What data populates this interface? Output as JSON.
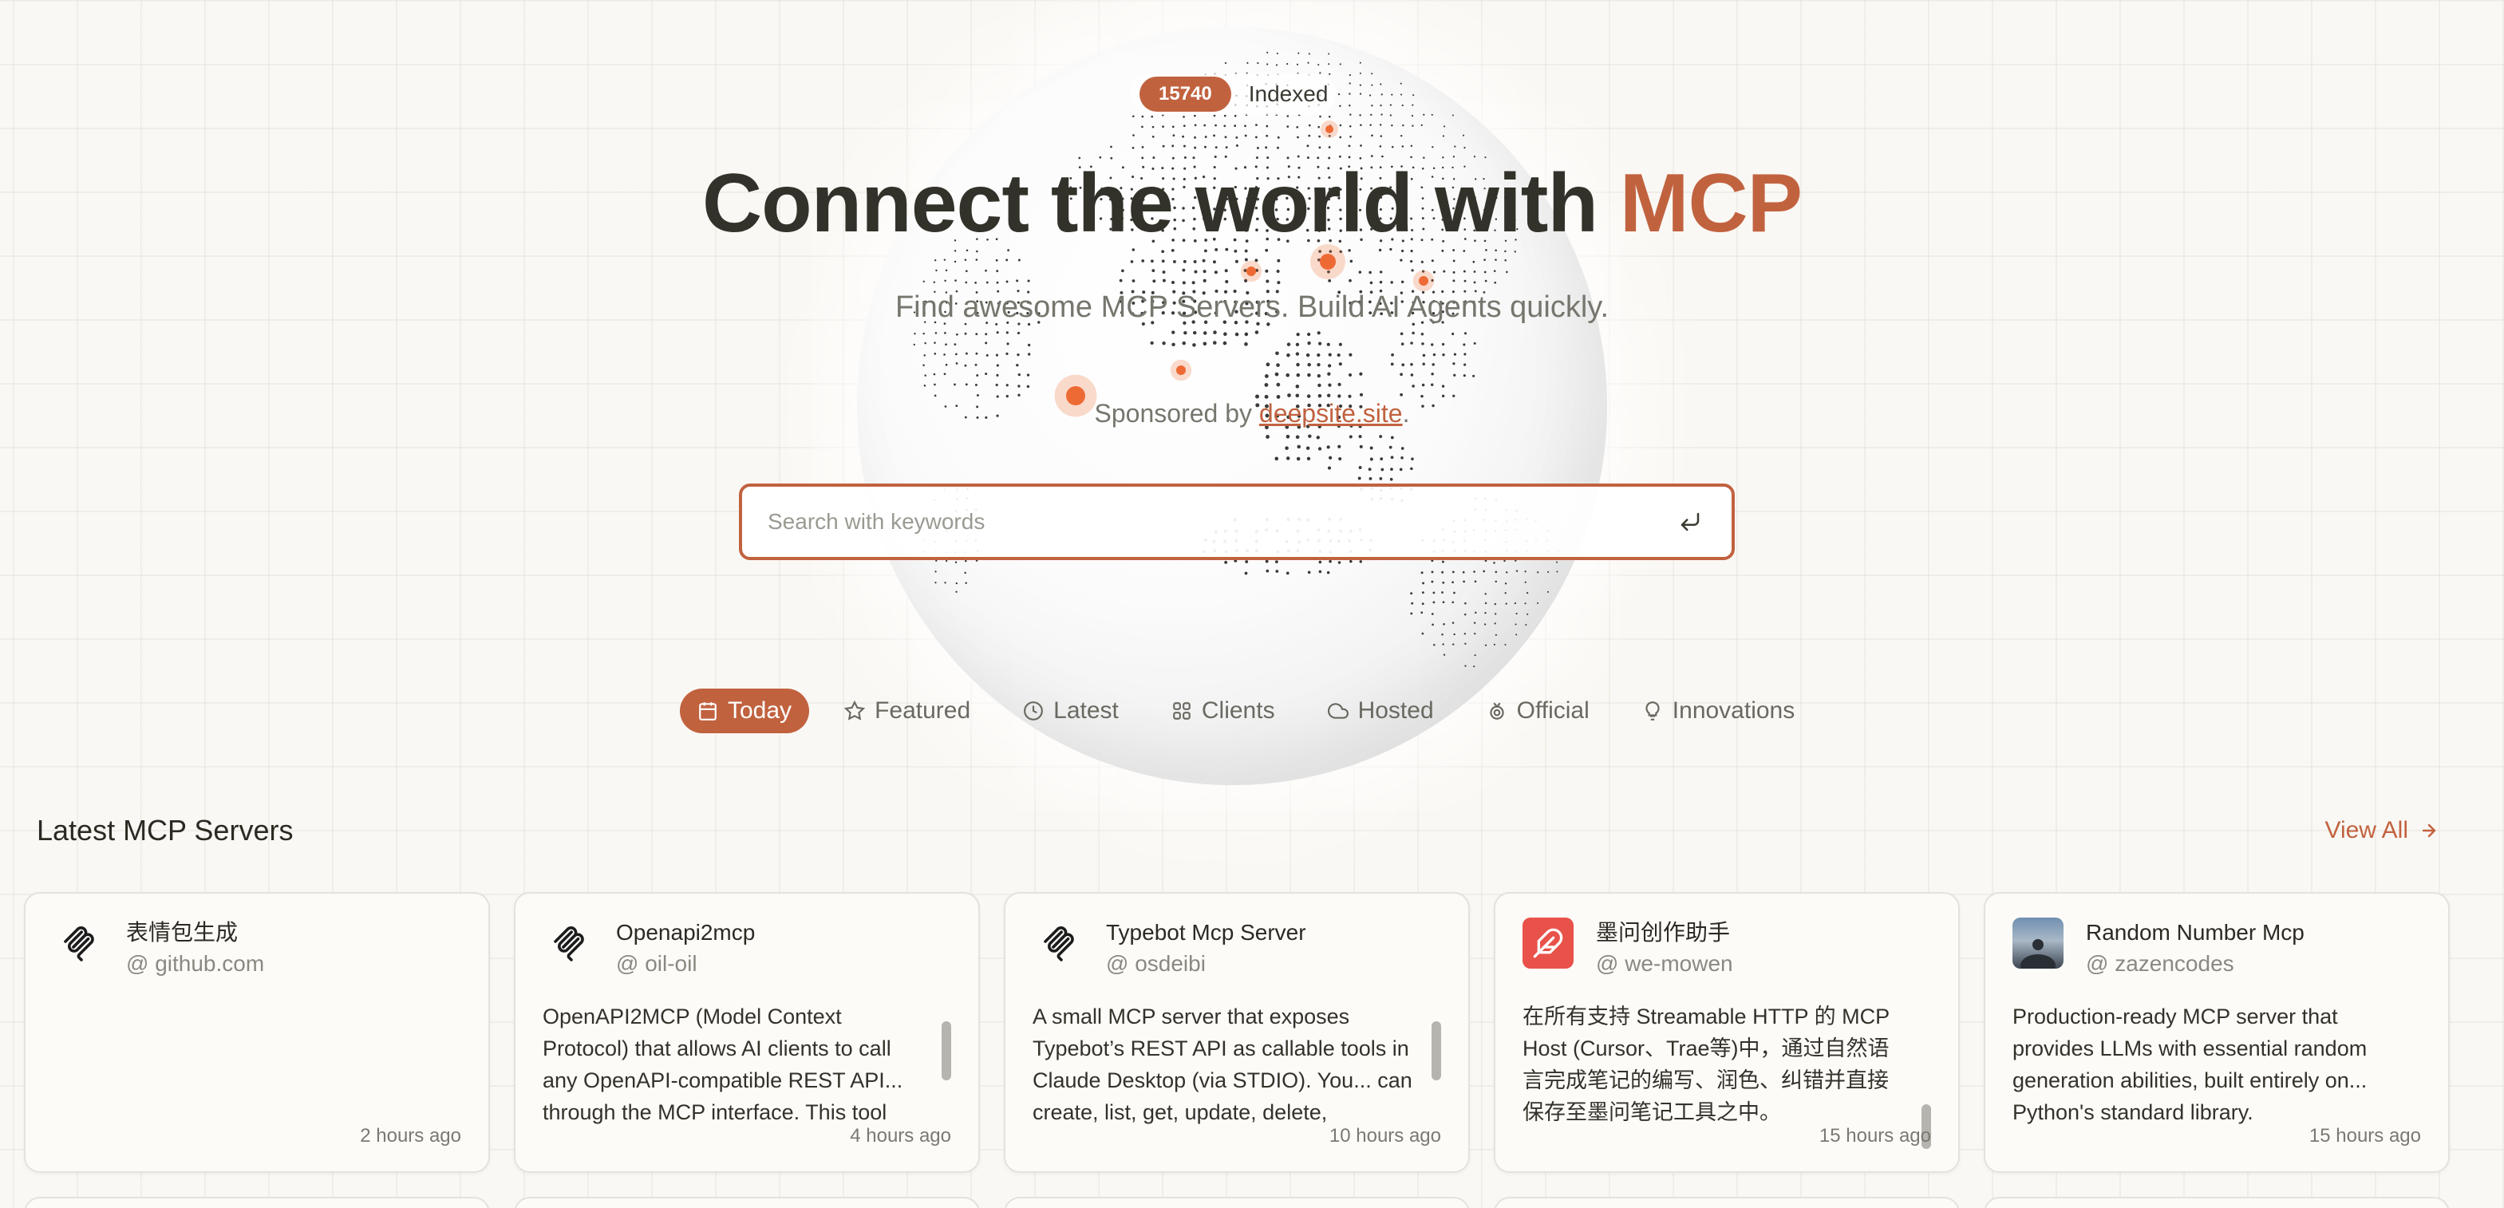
{
  "hero": {
    "indexed_count": "15740",
    "indexed_label": "Indexed",
    "title_main": "Connect the world with ",
    "title_accent": "MCP",
    "subtitle": "Find awesome MCP Servers. Build AI Agents quickly.",
    "sponsor_prefix": "Sponsored by ",
    "sponsor_link": "deepsite.site",
    "sponsor_suffix": "."
  },
  "search": {
    "placeholder": "Search with keywords",
    "value": ""
  },
  "tabs": [
    {
      "label": "Today",
      "icon": "calendar-icon",
      "active": true
    },
    {
      "label": "Featured",
      "icon": "star-icon"
    },
    {
      "label": "Latest",
      "icon": "clock-icon"
    },
    {
      "label": "Clients",
      "icon": "grid-icon"
    },
    {
      "label": "Hosted",
      "icon": "cloud-icon"
    },
    {
      "label": "Official",
      "icon": "medal-icon"
    },
    {
      "label": "Innovations",
      "icon": "lightbulb-icon"
    }
  ],
  "section": {
    "title": "Latest MCP Servers",
    "view_all": "View All"
  },
  "colors": {
    "accent": "#c1623f",
    "background": "#faf8f4"
  },
  "cards": [
    {
      "name": "表情包生成",
      "author": "@ github.com",
      "description": "",
      "time": "2 hours ago",
      "logo": "mcp-logo-icon"
    },
    {
      "name": "Openapi2mcp",
      "author": "@ oil-oil",
      "description": "OpenAPI2MCP (Model Context Protocol) that allows AI clients to call any OpenAPI-compatible REST API... through the MCP interface. This tool",
      "time": "4 hours ago",
      "logo": "mcp-logo-icon"
    },
    {
      "name": "Typebot Mcp Server",
      "author": "@ osdeibi",
      "description": "A small MCP server that exposes Typebot’s REST API as callable tools in Claude Desktop (via STDIO). You... can create, list, get, update, delete,",
      "time": "10 hours ago",
      "logo": "mcp-logo-icon"
    },
    {
      "name": "墨问创作助手",
      "author": "@ we-mowen",
      "description": "在所有支持 Streamable HTTP 的 MCP Host (Cursor、Trae等)中，通过自然语言完成笔记的编写、润色、纠错并直接保存至墨问笔记工具之中。",
      "time": "15 hours ago",
      "logo": "feather-icon"
    },
    {
      "name": "Random Number Mcp",
      "author": "@ zazencodes",
      "description": "Production-ready MCP server that provides LLMs with essential random generation abilities, built entirely on... Python's standard library.",
      "time": "15 hours ago",
      "logo": "avatar-photo"
    }
  ]
}
